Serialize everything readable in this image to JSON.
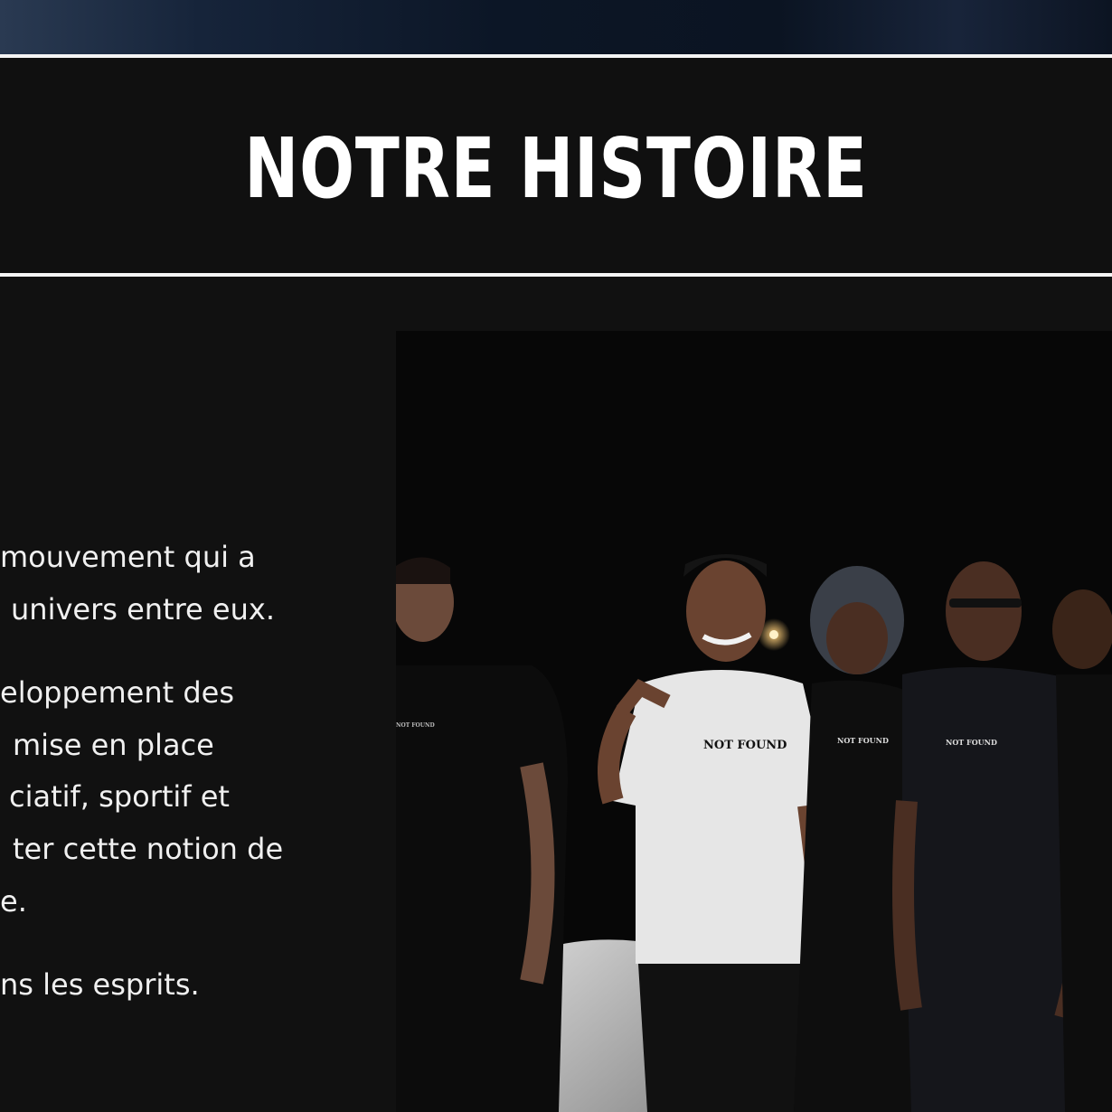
{
  "section": {
    "title": "NOTRE HISTOIRE"
  },
  "story": {
    "paragraphs": [
      [
        "mouvement qui a",
        "univers entre eux."
      ],
      [
        "eloppement des",
        "mise en place",
        "ciatif, sportif et",
        "ter cette notion de",
        "e."
      ],
      [
        "ns les esprits."
      ]
    ]
  },
  "photo": {
    "shirt_prints": [
      "NOT FOUND",
      "NOT FOUND",
      "NOT FOUND",
      "NOT FOUND"
    ],
    "description_icon": "group-photo"
  },
  "colors": {
    "background": "#111111",
    "rule": "#f4f4f4",
    "title": "#ffffff",
    "text": "#f0f0f0"
  }
}
